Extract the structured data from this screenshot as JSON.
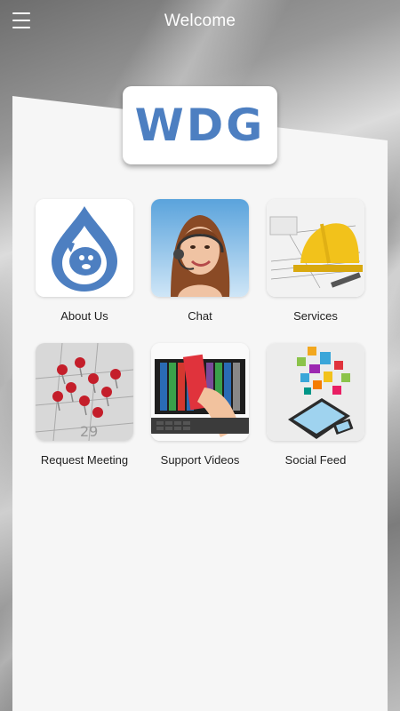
{
  "header": {
    "title": "Welcome",
    "menu_icon": "hamburger-menu-icon"
  },
  "logo": {
    "text": "WDG",
    "color": "#4d7fc1"
  },
  "tiles": [
    {
      "label": "About Us",
      "icon": "water-drop-dog-icon"
    },
    {
      "label": "Chat",
      "icon": "headset-agent-icon"
    },
    {
      "label": "Services",
      "icon": "hard-hat-icon"
    },
    {
      "label": "Request Meeting",
      "icon": "calendar-pins-icon"
    },
    {
      "label": "Support Videos",
      "icon": "laptop-books-icon"
    },
    {
      "label": "Social Feed",
      "icon": "social-devices-icon"
    }
  ]
}
